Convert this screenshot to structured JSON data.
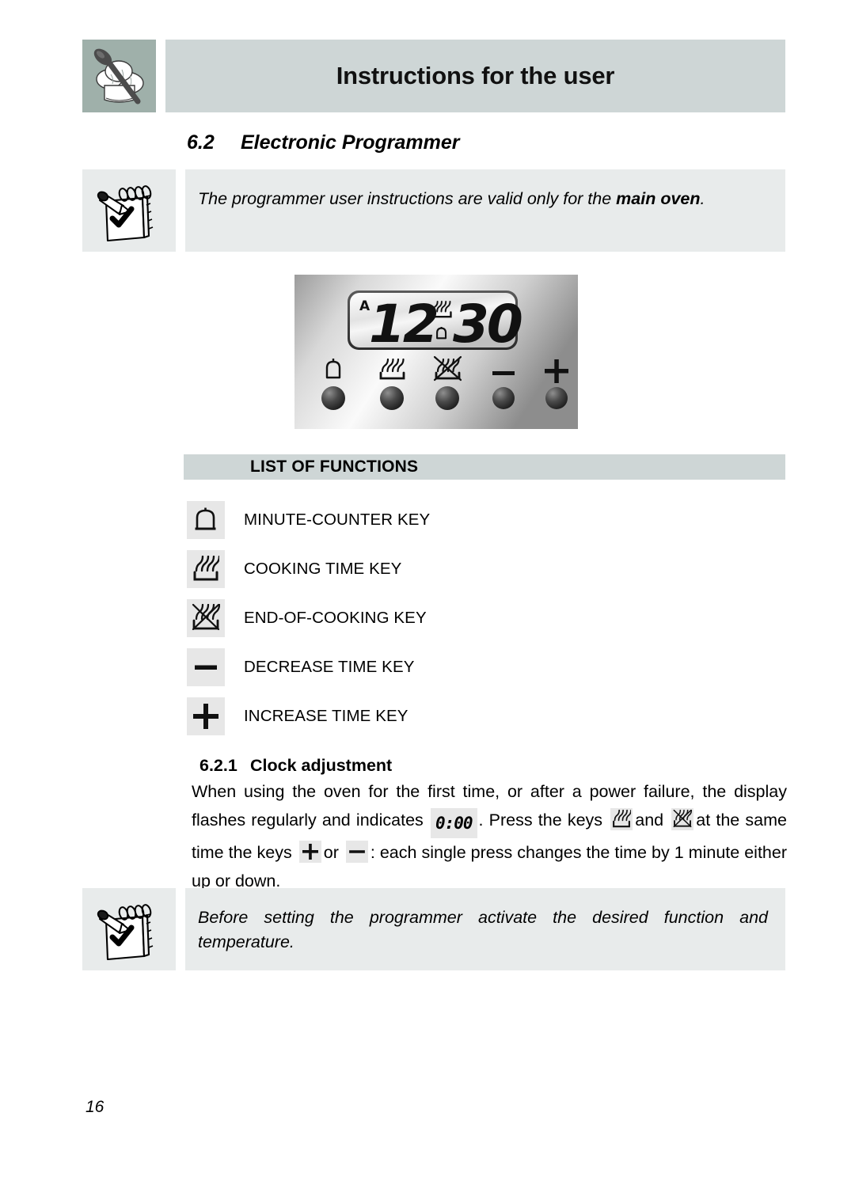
{
  "header": {
    "title": "Instructions for the user",
    "badge_icon": "chef-hat-spoon-icon"
  },
  "section": {
    "number": "6.2",
    "title": "Electronic Programmer"
  },
  "note_top": {
    "icon": "notepad-pen-check-icon",
    "text_before": "The programmer user instructions are valid only for the ",
    "text_bold": "main oven",
    "text_after": "."
  },
  "programmer_panel": {
    "display": {
      "auto_indicator": "A",
      "hours": "12",
      "minutes": "30",
      "separator_top_icon": "cooking-time-icon",
      "separator_bottom_icon": "minute-counter-bell-icon"
    },
    "buttons": [
      {
        "icon": "minute-counter-bell-icon",
        "name": "minute-counter-key"
      },
      {
        "icon": "cooking-time-icon",
        "name": "cooking-time-key"
      },
      {
        "icon": "end-of-cooking-icon",
        "name": "end-of-cooking-key"
      },
      {
        "icon": "minus-icon",
        "name": "decrease-time-key"
      },
      {
        "icon": "plus-icon",
        "name": "increase-time-key"
      }
    ]
  },
  "list_of_functions": {
    "heading": "LIST OF FUNCTIONS",
    "items": [
      {
        "icon": "minute-counter-bell-icon",
        "label": "MINUTE-COUNTER KEY"
      },
      {
        "icon": "cooking-time-icon",
        "label": "COOKING TIME KEY"
      },
      {
        "icon": "end-of-cooking-icon",
        "label": "END-OF-COOKING KEY"
      },
      {
        "icon": "minus-icon",
        "label": "DECREASE TIME KEY"
      },
      {
        "icon": "plus-icon",
        "label": "INCREASE TIME KEY"
      }
    ]
  },
  "clock_adjustment": {
    "number": "6.2.1",
    "title": "Clock adjustment",
    "p1": "When using the oven for the first time, or after a power failure, the display flashes regularly and indicates",
    "lcd_value": "0:00",
    "p2": ". Press the keys",
    "p3": "and",
    "p4": "at the same time the keys",
    "p5": "or",
    "p6": ": each single press changes the time by 1 minute either up or down."
  },
  "note_bottom": {
    "icon": "notepad-pen-check-icon",
    "text": "Before setting the programmer activate the desired function and temperature."
  },
  "footer": {
    "page_number": "16"
  },
  "colors": {
    "header_band": "#ced6d6",
    "badge_green": "#9fb0aa",
    "note_bg": "#e8ebeb",
    "icon_chip": "#e7e7e7",
    "text": "#000000"
  }
}
